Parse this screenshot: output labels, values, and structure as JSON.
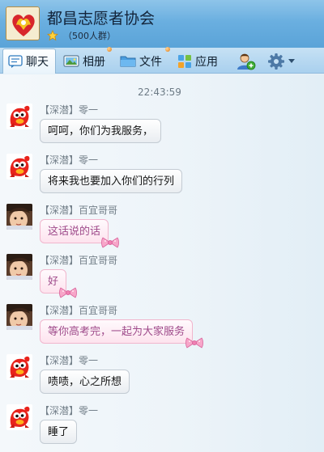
{
  "header": {
    "group_name": "都昌志愿者协会",
    "member_count": "（500人群）"
  },
  "tabs": [
    {
      "label": "聊天",
      "icon": "chat-icon",
      "active": true
    },
    {
      "label": "相册",
      "icon": "photo-album-icon",
      "notify": true
    },
    {
      "label": "文件",
      "icon": "folder-icon",
      "notify": true
    },
    {
      "label": "应用",
      "icon": "apps-grid-icon"
    }
  ],
  "toolbar_icons": [
    "add-member-icon",
    "settings-gear-icon",
    "dropdown-arrow-icon"
  ],
  "chat": {
    "timestamp": "22:43:59",
    "messages": [
      {
        "sender": "【深潜】零一",
        "text": "呵呵，你们为我服务，",
        "style": "plain",
        "avatar": "red-mascot-avatar"
      },
      {
        "sender": "【深潜】零一",
        "text": "将来我也要加入你们的行列",
        "style": "plain",
        "avatar": "red-mascot-avatar"
      },
      {
        "sender": "【深潜】百宜哥哥",
        "text": "这话说的话",
        "style": "pink",
        "avatar": "child-photo-avatar"
      },
      {
        "sender": "【深潜】百宜哥哥",
        "text": "好",
        "style": "pink",
        "avatar": "child-photo-avatar"
      },
      {
        "sender": "【深潜】百宜哥哥",
        "text": "等你高考完，一起为大家服务",
        "style": "pink",
        "avatar": "child-photo-avatar"
      },
      {
        "sender": "【深潜】零一",
        "text": "啧啧，心之所想",
        "style": "plain",
        "avatar": "red-mascot-avatar"
      },
      {
        "sender": "【深潜】零一",
        "text": "睡了",
        "style": "plain",
        "avatar": "red-mascot-avatar"
      }
    ]
  },
  "colors": {
    "header_blue": "#6aafe0",
    "pink_bubble_text": "#9e4a8a",
    "pink_bubble_border": "#f1b6cd"
  }
}
